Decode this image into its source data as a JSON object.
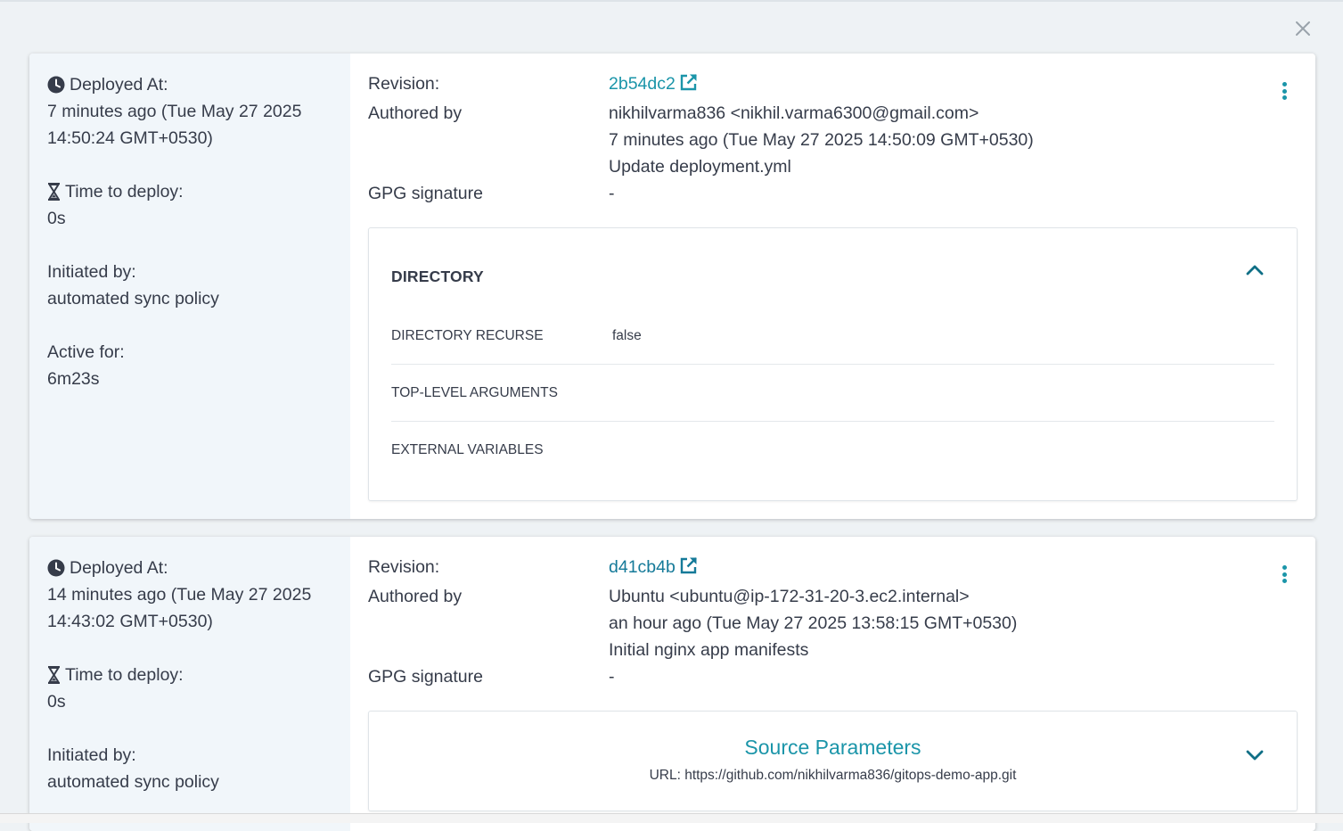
{
  "dialog": {
    "close_icon": "close-icon"
  },
  "deployments": [
    {
      "left": {
        "deployed_at_label": "Deployed At:",
        "deployed_at_line1": "7 minutes ago (Tue May 27 2025",
        "deployed_at_line2": "14:50:24 GMT+0530)",
        "time_to_deploy_label": "Time to deploy:",
        "time_to_deploy_value": "0s",
        "initiated_by_label": "Initiated by:",
        "initiated_by_value": "automated sync policy",
        "active_for_label": "Active for:",
        "active_for_value": "6m23s"
      },
      "revision": {
        "revision_label": "Revision:",
        "revision_value": "2b54dc2",
        "authored_label": "Authored by",
        "author": "nikhilvarma836 <nikhil.varma6300@gmail.com>",
        "date": "7 minutes ago (Tue May 27 2025 14:50:09 GMT+0530)",
        "message": "Update deployment.yml",
        "gpg_label": "GPG signature",
        "gpg_value": "-"
      },
      "directory": {
        "title": "DIRECTORY",
        "rows": [
          {
            "key": "DIRECTORY RECURSE",
            "value": "false"
          },
          {
            "key": "TOP-LEVEL ARGUMENTS",
            "value": ""
          },
          {
            "key": "EXTERNAL VARIABLES",
            "value": ""
          }
        ]
      }
    },
    {
      "left": {
        "deployed_at_label": "Deployed At:",
        "deployed_at_line1": "14 minutes ago (Tue May 27 2025",
        "deployed_at_line2": "14:43:02 GMT+0530)",
        "time_to_deploy_label": "Time to deploy:",
        "time_to_deploy_value": "0s",
        "initiated_by_label": "Initiated by:",
        "initiated_by_value": "automated sync policy"
      },
      "revision": {
        "revision_label": "Revision:",
        "revision_value": "d41cb4b",
        "authored_label": "Authored by",
        "author": "Ubuntu <ubuntu@ip-172-31-20-3.ec2.internal>",
        "date": "an hour ago (Tue May 27 2025 13:58:15 GMT+0530)",
        "message": "Initial nginx app manifests",
        "gpg_label": "GPG signature",
        "gpg_value": "-"
      },
      "source": {
        "title": "Source Parameters",
        "url_text": "URL: https://github.com/nikhilvarma836/gitops-demo-app.git"
      }
    }
  ],
  "colors": {
    "accent": "#1b95a9",
    "text": "#363c4a",
    "left_panel": "#f1f6fa",
    "background": "#eef2f5"
  }
}
